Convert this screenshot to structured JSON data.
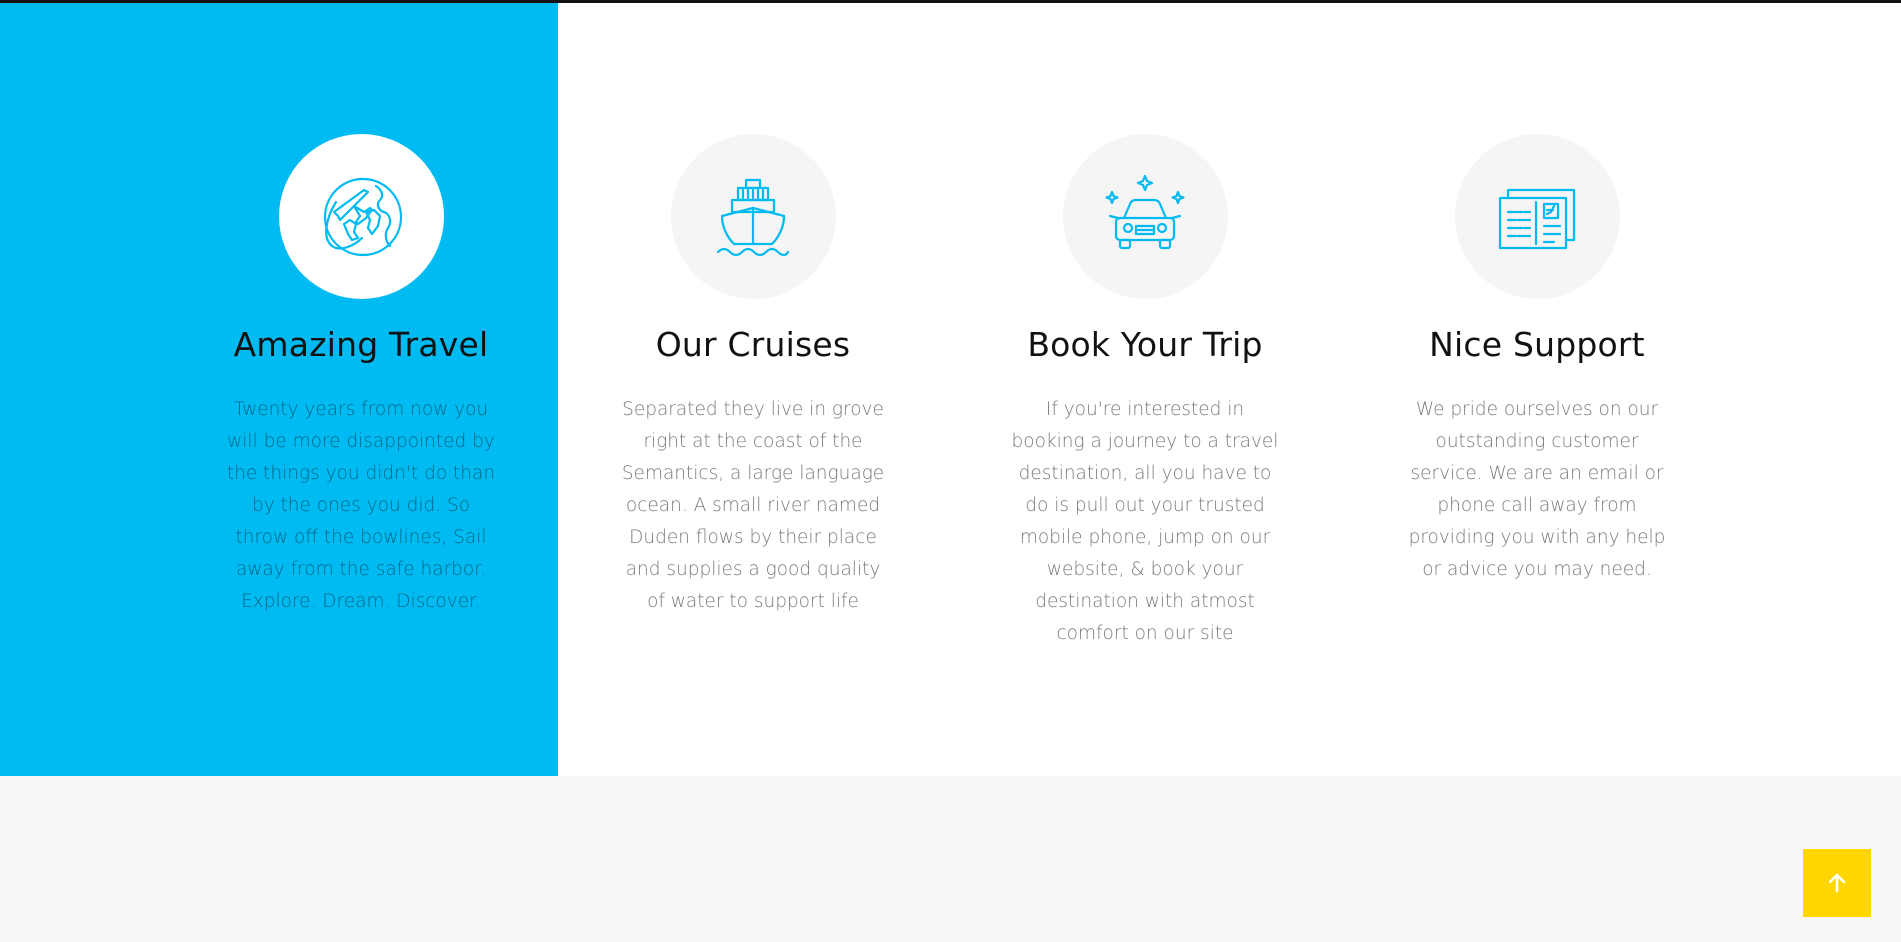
{
  "colors": {
    "accent": "#00baf2",
    "scroll_button": "#ffd600"
  },
  "services": [
    {
      "icon": "globe-plane-icon",
      "title": "Amazing Travel",
      "text": "Twenty years from now you will be more disappointed by the things you didn't do than by the ones you did. So throw off the bowlines, Sail away from the safe harbor. Explore. Dream. Discover."
    },
    {
      "icon": "cruise-ship-icon",
      "title": "Our Cruises",
      "text": "Separated they live in grove right at the coast of the Semantics, a large language ocean. A small river named Duden flows by their place and supplies a good quality of water to support life"
    },
    {
      "icon": "car-icon",
      "title": "Book Your Trip",
      "text": "If you're interested in booking a journey to a travel destination, all you have to do is pull out your trusted mobile phone, jump on our website, & book your destination with atmost comfort on our site"
    },
    {
      "icon": "ticket-icon",
      "title": "Nice Support",
      "text": "We pride ourselves on our outstanding customer service. We are an email or phone call away from providing you with any help or advice you may need."
    }
  ],
  "scroll_top": {
    "icon": "arrow-up-icon"
  }
}
